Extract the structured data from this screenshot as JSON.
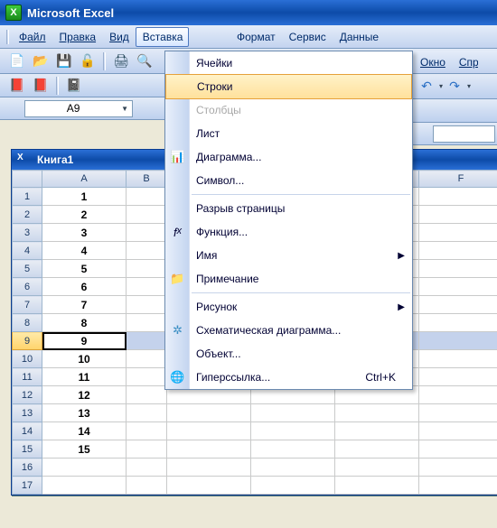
{
  "app": {
    "title": "Microsoft Excel"
  },
  "menubar": {
    "file": "Файл",
    "edit": "Правка",
    "view": "Вид",
    "insert": "Вставка",
    "format": "Формат",
    "tools": "Сервис",
    "data": "Данные",
    "window": "Окно",
    "help": "Спра"
  },
  "namebox": {
    "value": "A9"
  },
  "workbook": {
    "title": "Книга1"
  },
  "columns": {
    "A": "A",
    "B": "B",
    "F": "F"
  },
  "rows": {
    "1": {
      "hdr": "1",
      "A": "1"
    },
    "2": {
      "hdr": "2",
      "A": "2"
    },
    "3": {
      "hdr": "3",
      "A": "3"
    },
    "4": {
      "hdr": "4",
      "A": "4"
    },
    "5": {
      "hdr": "5",
      "A": "5"
    },
    "6": {
      "hdr": "6",
      "A": "6"
    },
    "7": {
      "hdr": "7",
      "A": "7"
    },
    "8": {
      "hdr": "8",
      "A": "8"
    },
    "9": {
      "hdr": "9",
      "A": "9"
    },
    "10": {
      "hdr": "10",
      "A": "10"
    },
    "11": {
      "hdr": "11",
      "A": "11"
    },
    "12": {
      "hdr": "12",
      "A": "12"
    },
    "13": {
      "hdr": "13",
      "A": "13"
    },
    "14": {
      "hdr": "14",
      "A": "14"
    },
    "15": {
      "hdr": "15",
      "A": "15"
    },
    "16": {
      "hdr": "16",
      "A": ""
    },
    "17": {
      "hdr": "17",
      "A": ""
    }
  },
  "menu": {
    "cells": "Ячейки",
    "rows": "Строки",
    "columns": "Столбцы",
    "sheet": "Лист",
    "chart": "Диаграмма...",
    "symbol": "Символ...",
    "pagebreak": "Разрыв страницы",
    "function": "Функция...",
    "name": "Имя",
    "comment": "Примечание",
    "picture": "Рисунок",
    "schematic": "Схематическая диаграмма...",
    "object": "Объект...",
    "hyperlink": "Гиперссылка...",
    "hyperlink_key": "Ctrl+K"
  }
}
